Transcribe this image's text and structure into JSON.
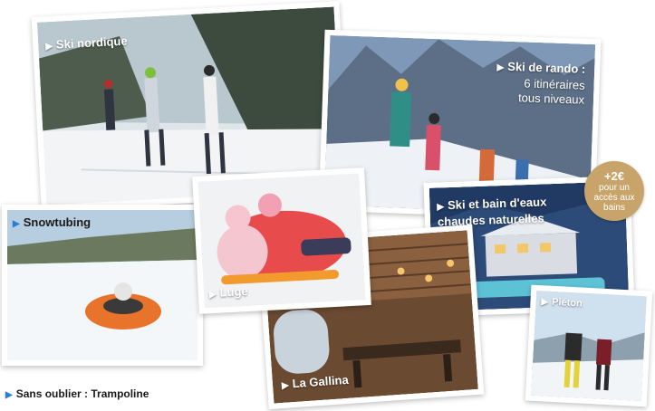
{
  "cards": {
    "ski_nordique": {
      "label": "Ski nordique"
    },
    "ski_rando": {
      "label": "Ski de rando :",
      "sub1": "6 itinéraires",
      "sub2": "tous niveaux"
    },
    "snowtubing": {
      "label": "Snowtubing"
    },
    "luge": {
      "label": "Luge"
    },
    "bains": {
      "label_line1": "Ski et bain d'eaux",
      "label_line2": "chaudes naturelles"
    },
    "la_gallina": {
      "label": "La Gallina"
    },
    "pieton": {
      "label": "Piéton"
    }
  },
  "badge": {
    "price": "+2€",
    "line1": "pour un",
    "line2": "accès aux",
    "line3": "bains"
  },
  "footer": {
    "text": "Sans oublier : Trampoline"
  },
  "colors": {
    "accent": "#2a7fd0",
    "badge": "#c9a46a"
  }
}
